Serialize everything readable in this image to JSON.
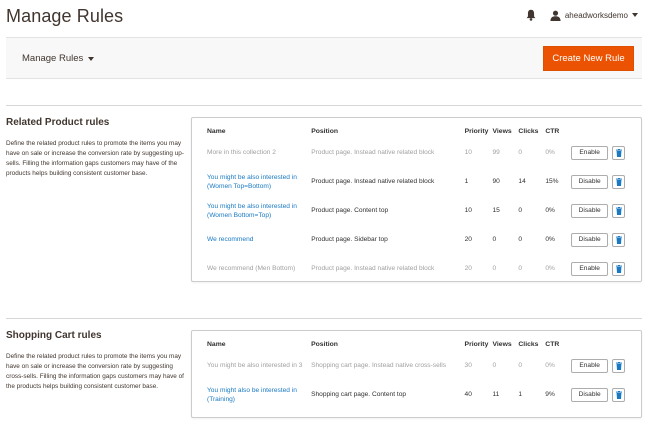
{
  "header": {
    "title": "Manage Rules",
    "username": "aheadworksdemo"
  },
  "actions": {
    "switcher_label": "Manage Rules",
    "create_label": "Create New Rule"
  },
  "colors": {
    "primary_button": "#eb5202",
    "link": "#1979c3",
    "inactive_text": "#a0a0a0"
  },
  "icons": [
    "bell-icon",
    "user-icon",
    "caret-down-icon",
    "trash-icon"
  ],
  "columns": [
    "Name",
    "Position",
    "Priority",
    "Views",
    "Clicks",
    "CTR"
  ],
  "related": {
    "title": "Related Product rules",
    "description": "Define the related product rules to promote the items you may have on sale or increase the conversion rate by suggesting up-sells. Filling the information gaps customers may have of the products helps building consistent customer base.",
    "rows": [
      {
        "name": "More in this collection 2",
        "position": "Product page. Instead native related block",
        "priority": "10",
        "views": "99",
        "clicks": "0",
        "ctr": "0%",
        "toggle": "Enable",
        "active": false
      },
      {
        "name": "You might be also interested in (Women Top=Bottom)",
        "position": "Product page. Instead native related block",
        "priority": "1",
        "views": "90",
        "clicks": "14",
        "ctr": "15%",
        "toggle": "Disable",
        "active": true
      },
      {
        "name": "You might be also interested in (Women Bottom=Top)",
        "position": "Product page. Content top",
        "priority": "10",
        "views": "15",
        "clicks": "0",
        "ctr": "0%",
        "toggle": "Disable",
        "active": true
      },
      {
        "name": "We recommend",
        "position": "Product page. Sidebar top",
        "priority": "20",
        "views": "0",
        "clicks": "0",
        "ctr": "0%",
        "toggle": "Disable",
        "active": true
      },
      {
        "name": "We recommend (Men Bottom)",
        "position": "Product page. Instead native related block",
        "priority": "20",
        "views": "0",
        "clicks": "0",
        "ctr": "0%",
        "toggle": "Enable",
        "active": false
      }
    ]
  },
  "cart": {
    "title": "Shopping Cart rules",
    "description": "Define the related product rules to promote the items you may have on sale or increase the conversion rate by suggesting cross-sells. Filling the information gaps customers may have of the products helps building consistent customer base.",
    "rows": [
      {
        "name": "You might be also interested in 3",
        "position": "Shopping cart page. Instead native cross-sells",
        "priority": "30",
        "views": "0",
        "clicks": "0",
        "ctr": "0%",
        "toggle": "Enable",
        "active": false
      },
      {
        "name": "You might also be interested in (Training)",
        "position": "Shopping cart page. Content top",
        "priority": "40",
        "views": "11",
        "clicks": "1",
        "ctr": "9%",
        "toggle": "Disable",
        "active": true
      }
    ]
  }
}
